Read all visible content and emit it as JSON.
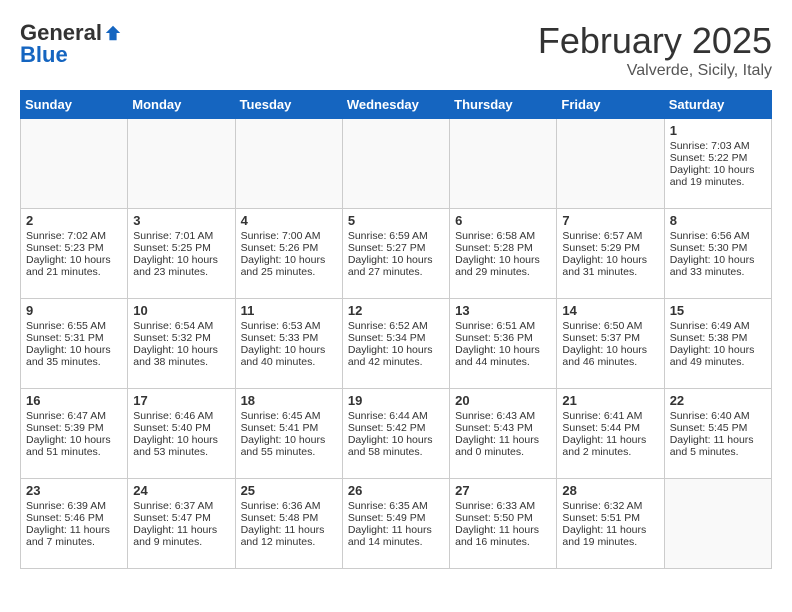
{
  "header": {
    "logo_general": "General",
    "logo_blue": "Blue",
    "month_title": "February 2025",
    "location": "Valverde, Sicily, Italy"
  },
  "days_of_week": [
    "Sunday",
    "Monday",
    "Tuesday",
    "Wednesday",
    "Thursday",
    "Friday",
    "Saturday"
  ],
  "weeks": [
    [
      {
        "day": "",
        "info": ""
      },
      {
        "day": "",
        "info": ""
      },
      {
        "day": "",
        "info": ""
      },
      {
        "day": "",
        "info": ""
      },
      {
        "day": "",
        "info": ""
      },
      {
        "day": "",
        "info": ""
      },
      {
        "day": "1",
        "info": "Sunrise: 7:03 AM\nSunset: 5:22 PM\nDaylight: 10 hours and 19 minutes."
      }
    ],
    [
      {
        "day": "2",
        "info": "Sunrise: 7:02 AM\nSunset: 5:23 PM\nDaylight: 10 hours and 21 minutes."
      },
      {
        "day": "3",
        "info": "Sunrise: 7:01 AM\nSunset: 5:25 PM\nDaylight: 10 hours and 23 minutes."
      },
      {
        "day": "4",
        "info": "Sunrise: 7:00 AM\nSunset: 5:26 PM\nDaylight: 10 hours and 25 minutes."
      },
      {
        "day": "5",
        "info": "Sunrise: 6:59 AM\nSunset: 5:27 PM\nDaylight: 10 hours and 27 minutes."
      },
      {
        "day": "6",
        "info": "Sunrise: 6:58 AM\nSunset: 5:28 PM\nDaylight: 10 hours and 29 minutes."
      },
      {
        "day": "7",
        "info": "Sunrise: 6:57 AM\nSunset: 5:29 PM\nDaylight: 10 hours and 31 minutes."
      },
      {
        "day": "8",
        "info": "Sunrise: 6:56 AM\nSunset: 5:30 PM\nDaylight: 10 hours and 33 minutes."
      }
    ],
    [
      {
        "day": "9",
        "info": "Sunrise: 6:55 AM\nSunset: 5:31 PM\nDaylight: 10 hours and 35 minutes."
      },
      {
        "day": "10",
        "info": "Sunrise: 6:54 AM\nSunset: 5:32 PM\nDaylight: 10 hours and 38 minutes."
      },
      {
        "day": "11",
        "info": "Sunrise: 6:53 AM\nSunset: 5:33 PM\nDaylight: 10 hours and 40 minutes."
      },
      {
        "day": "12",
        "info": "Sunrise: 6:52 AM\nSunset: 5:34 PM\nDaylight: 10 hours and 42 minutes."
      },
      {
        "day": "13",
        "info": "Sunrise: 6:51 AM\nSunset: 5:36 PM\nDaylight: 10 hours and 44 minutes."
      },
      {
        "day": "14",
        "info": "Sunrise: 6:50 AM\nSunset: 5:37 PM\nDaylight: 10 hours and 46 minutes."
      },
      {
        "day": "15",
        "info": "Sunrise: 6:49 AM\nSunset: 5:38 PM\nDaylight: 10 hours and 49 minutes."
      }
    ],
    [
      {
        "day": "16",
        "info": "Sunrise: 6:47 AM\nSunset: 5:39 PM\nDaylight: 10 hours and 51 minutes."
      },
      {
        "day": "17",
        "info": "Sunrise: 6:46 AM\nSunset: 5:40 PM\nDaylight: 10 hours and 53 minutes."
      },
      {
        "day": "18",
        "info": "Sunrise: 6:45 AM\nSunset: 5:41 PM\nDaylight: 10 hours and 55 minutes."
      },
      {
        "day": "19",
        "info": "Sunrise: 6:44 AM\nSunset: 5:42 PM\nDaylight: 10 hours and 58 minutes."
      },
      {
        "day": "20",
        "info": "Sunrise: 6:43 AM\nSunset: 5:43 PM\nDaylight: 11 hours and 0 minutes."
      },
      {
        "day": "21",
        "info": "Sunrise: 6:41 AM\nSunset: 5:44 PM\nDaylight: 11 hours and 2 minutes."
      },
      {
        "day": "22",
        "info": "Sunrise: 6:40 AM\nSunset: 5:45 PM\nDaylight: 11 hours and 5 minutes."
      }
    ],
    [
      {
        "day": "23",
        "info": "Sunrise: 6:39 AM\nSunset: 5:46 PM\nDaylight: 11 hours and 7 minutes."
      },
      {
        "day": "24",
        "info": "Sunrise: 6:37 AM\nSunset: 5:47 PM\nDaylight: 11 hours and 9 minutes."
      },
      {
        "day": "25",
        "info": "Sunrise: 6:36 AM\nSunset: 5:48 PM\nDaylight: 11 hours and 12 minutes."
      },
      {
        "day": "26",
        "info": "Sunrise: 6:35 AM\nSunset: 5:49 PM\nDaylight: 11 hours and 14 minutes."
      },
      {
        "day": "27",
        "info": "Sunrise: 6:33 AM\nSunset: 5:50 PM\nDaylight: 11 hours and 16 minutes."
      },
      {
        "day": "28",
        "info": "Sunrise: 6:32 AM\nSunset: 5:51 PM\nDaylight: 11 hours and 19 minutes."
      },
      {
        "day": "",
        "info": ""
      }
    ]
  ]
}
